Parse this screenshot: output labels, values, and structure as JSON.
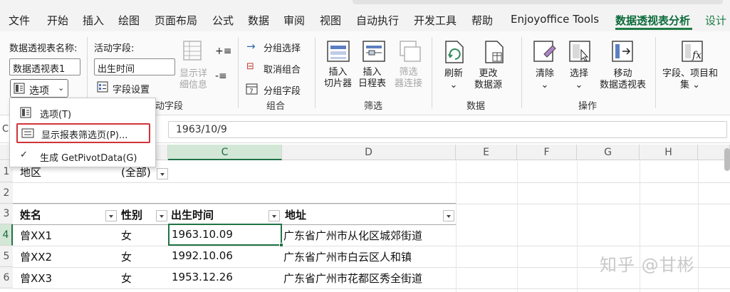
{
  "menu": {
    "tabs": [
      {
        "label": "文件"
      },
      {
        "label": "开始"
      },
      {
        "label": "插入"
      },
      {
        "label": "绘图"
      },
      {
        "label": "页面布局"
      },
      {
        "label": "公式"
      },
      {
        "label": "数据"
      },
      {
        "label": "审阅"
      },
      {
        "label": "视图"
      },
      {
        "label": "自动执行"
      },
      {
        "label": "开发工具"
      },
      {
        "label": "帮助"
      },
      {
        "label": "Enjoyoffice Tools"
      },
      {
        "label": "数据透视表分析"
      },
      {
        "label": "设计"
      }
    ],
    "active_tab": "数据透视表分析",
    "accent_color": "#1e7b45"
  },
  "ribbon": {
    "pivot_name_label": "数据透视表名称:",
    "pivot_name_value": "数据透视表1",
    "options_button": "选项",
    "active_field_label": "活动字段:",
    "active_field_value": "出生时间",
    "field_settings": "字段设置",
    "show_detail_line1": "显示详",
    "show_detail_line2": "细信息",
    "active_field_group": "动字段",
    "group_selection": "分组选择",
    "ungroup": "取消组合",
    "group_field": "分组字段",
    "group_label": "组合",
    "insert_slicer_line1": "插入",
    "insert_slicer_line2": "切片器",
    "insert_timeline_line1": "插入",
    "insert_timeline_line2": "日程表",
    "filter_conn_line1": "筛选",
    "filter_conn_line2": "器连接",
    "filter_label": "筛选",
    "refresh": "刷新",
    "change_source_line1": "更改",
    "change_source_line2": "数据源",
    "data_label": "数据",
    "clear": "清除",
    "select": "选择",
    "move_line1": "移动",
    "move_line2": "数据透视表",
    "actions_label": "操作",
    "fields_items_line1": "字段、项目和",
    "fields_items_line2": "集"
  },
  "dropdown": {
    "items": [
      {
        "label": "选项(T)"
      },
      {
        "label": "显示报表筛选页(P)..."
      },
      {
        "label": "生成 GetPivotData(G)"
      }
    ]
  },
  "formula_bar": {
    "name_box": "C",
    "value": "1963/10/9"
  },
  "grid": {
    "columns": [
      "C",
      "D",
      "E",
      "F",
      "G",
      "H"
    ],
    "selected_column": "C",
    "rows": [
      "1",
      "2",
      "3",
      "4",
      "5",
      "6"
    ],
    "selected_row": "4",
    "filter_field": {
      "label": "地区",
      "value": "(全部)"
    },
    "headers": [
      "姓名",
      "性别",
      "出生时间",
      "地址"
    ],
    "records": [
      [
        "曾XX1",
        "女",
        "1963.10.09",
        "广东省广州市从化区城郊街道"
      ],
      [
        "曾XX2",
        "女",
        "1992.10.06",
        "广东省广州市白云区人和镇"
      ],
      [
        "曾XX3",
        "女",
        "1953.12.26",
        "广东省广州市花都区秀全街道"
      ]
    ]
  },
  "watermark": "知乎 @甘彬"
}
